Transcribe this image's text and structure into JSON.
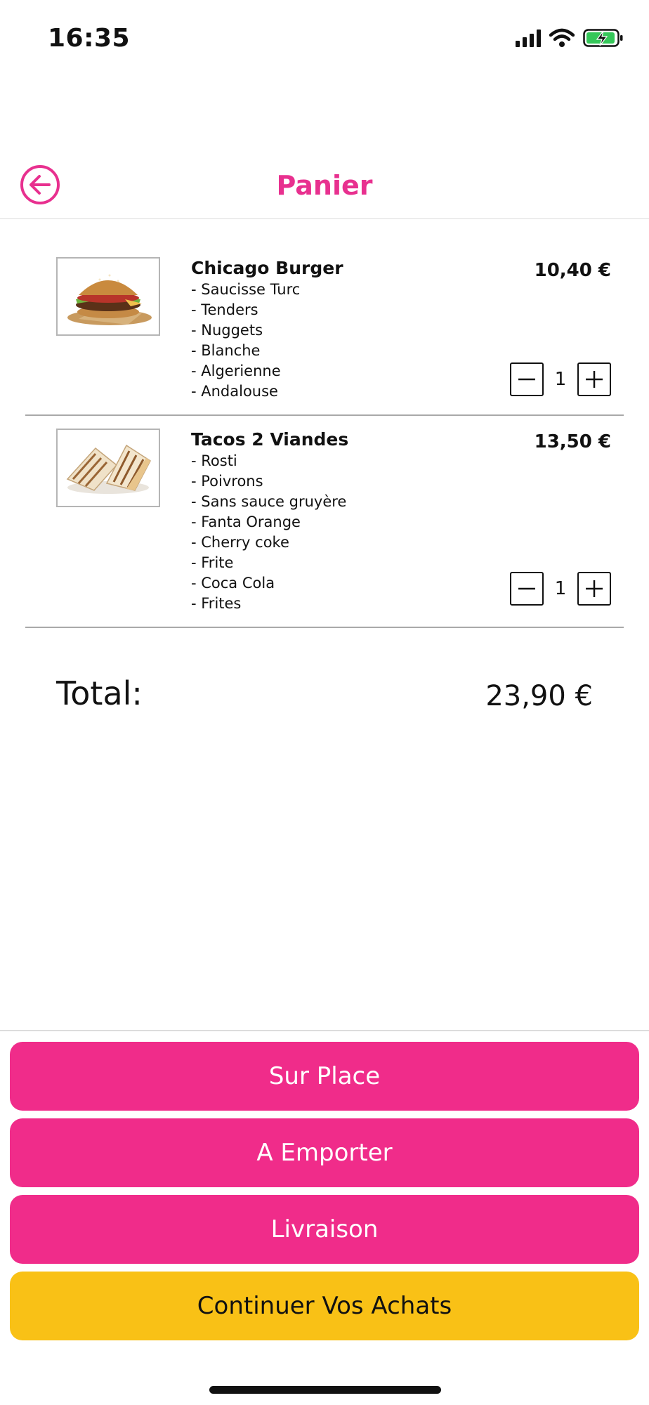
{
  "status_bar": {
    "time": "16:35"
  },
  "header": {
    "title": "Panier"
  },
  "cart": {
    "items": [
      {
        "name": "Chicago Burger",
        "price": "10,40 €",
        "quantity": "1",
        "options": [
          "- Saucisse Turc",
          "- Tenders",
          "- Nuggets",
          "- Blanche",
          "- Algerienne",
          "- Andalouse"
        ]
      },
      {
        "name": "Tacos 2 Viandes",
        "price": "13,50 €",
        "quantity": "1",
        "options": [
          "- Rosti",
          "- Poivrons",
          "- Sans sauce gruyère",
          "- Fanta Orange",
          "- Cherry coke",
          "- Frite",
          "- Coca Cola",
          "- Frites"
        ]
      }
    ]
  },
  "total": {
    "label": "Total:",
    "value": "23,90 €"
  },
  "actions": {
    "sur_place": "Sur Place",
    "a_emporter": "A Emporter",
    "livraison": "Livraison",
    "continuer": "Continuer Vos Achats"
  },
  "colors": {
    "accent": "#e8308f",
    "button_pink": "#f02c8a",
    "button_yellow": "#f9c116"
  },
  "icons": {
    "back": "arrow-left-circle-icon",
    "minus": "minus-icon",
    "plus": "plus-icon",
    "signal": "cellular-signal-icon",
    "wifi": "wifi-icon",
    "battery": "battery-charging-icon"
  }
}
